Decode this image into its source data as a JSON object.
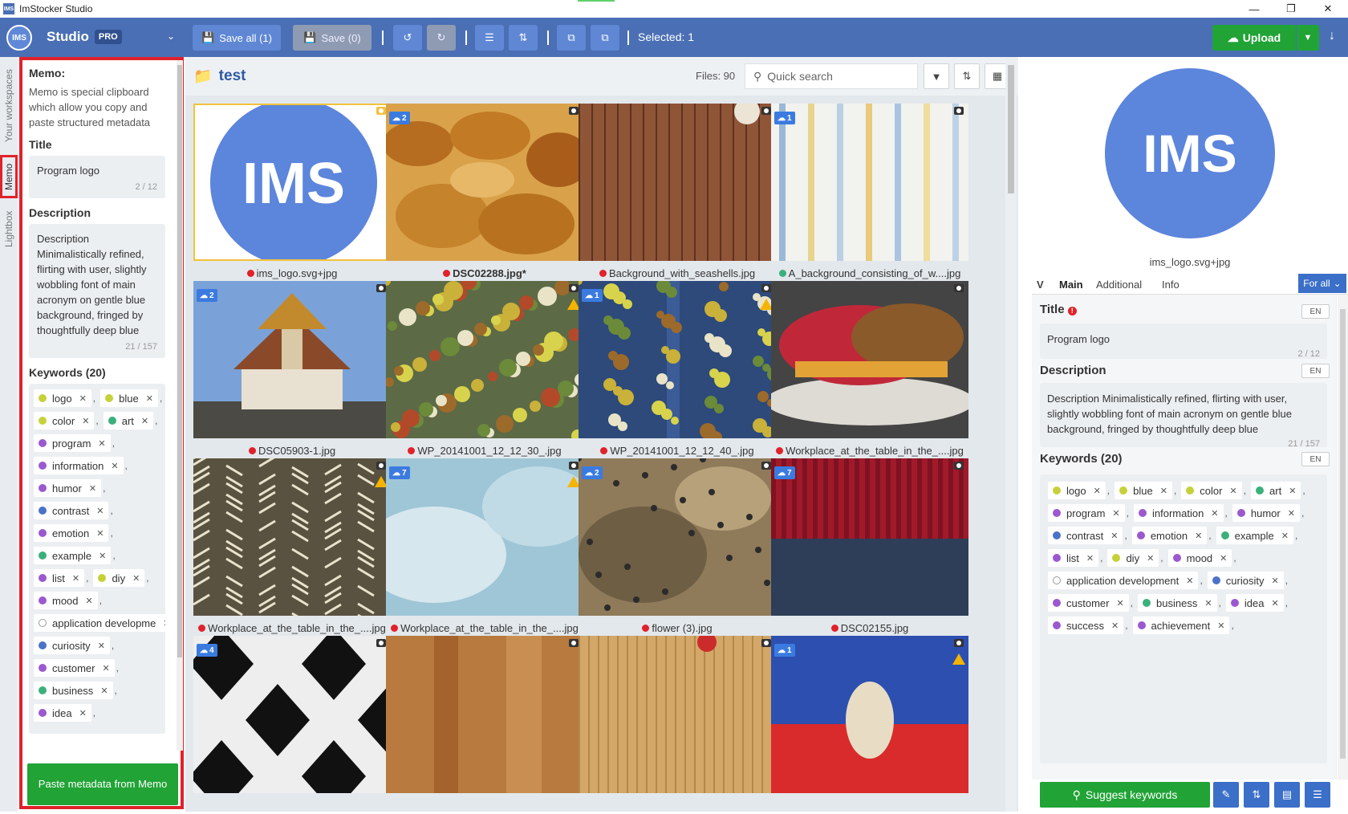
{
  "window": {
    "title": "ImStocker Studio",
    "app_icon": "IMS"
  },
  "toolbar": {
    "avatar": "IMS",
    "studio": "Studio",
    "pro": "PRO",
    "save_all": "Save all (1)",
    "save": "Save (0)",
    "selected": "Selected: 1",
    "upload": "Upload"
  },
  "side_tabs": [
    "Your workspaces",
    "Memo",
    "Lightbox"
  ],
  "memo": {
    "heading": "Memo:",
    "intro": "Memo is special clipboard which allow you copy and paste structured metadata",
    "title_label": "Title",
    "title_value": "Program logo",
    "title_count": "2 / 12",
    "desc_label": "Description",
    "desc_value": "Description Minimalistically refined, flirting with user, slightly wobbling font of main acronym on gentle blue background, fringed by thoughtfully deep blue",
    "desc_count": "21 / 157",
    "kw_label": "Keywords (20)",
    "keyword_lines": [
      [
        {
          "t": "logo",
          "c": "#c6d13a"
        },
        {
          "t": "blue",
          "c": "#c6d13a"
        }
      ],
      [
        {
          "t": "color",
          "c": "#c6d13a"
        },
        {
          "t": "art",
          "c": "#3bb07c"
        }
      ],
      [
        {
          "t": "program",
          "c": "#9b59d0"
        }
      ],
      [
        {
          "t": "information",
          "c": "#9b59d0"
        }
      ],
      [
        {
          "t": "humor",
          "c": "#9b59d0"
        }
      ],
      [
        {
          "t": "contrast",
          "c": "#4a72c8"
        }
      ],
      [
        {
          "t": "emotion",
          "c": "#9b59d0"
        }
      ],
      [
        {
          "t": "example",
          "c": "#3bb07c"
        }
      ],
      [
        {
          "t": "list",
          "c": "#9b59d0"
        },
        {
          "t": "diy",
          "c": "#c6d13a"
        }
      ],
      [
        {
          "t": "mood",
          "c": "#9b59d0"
        }
      ],
      [
        {
          "t": "application developme",
          "c": "#ffffff"
        }
      ],
      [
        {
          "t": "curiosity",
          "c": "#4a72c8"
        }
      ],
      [
        {
          "t": "customer",
          "c": "#9b59d0"
        }
      ],
      [
        {
          "t": "business",
          "c": "#3bb07c"
        }
      ],
      [
        {
          "t": "idea",
          "c": "#9b59d0"
        }
      ]
    ],
    "paste_button": "Paste metadata from Memo"
  },
  "center": {
    "folder": "test",
    "files": "Files: 90",
    "search_placeholder": "Quick search",
    "tiles": [
      {
        "name": "ims_logo.svg+jpg",
        "badge": "",
        "kind": "logo",
        "sel": true,
        "dot": "#e0222b",
        "bold": false,
        "warn": false
      },
      {
        "name": "DSC02288.jpg*",
        "badge": "2",
        "kind": "bread",
        "sel": false,
        "dot": "#e0222b",
        "bold": true,
        "warn": false
      },
      {
        "name": "Background_with_seashells.jpg",
        "badge": "",
        "kind": "wood",
        "sel": false,
        "dot": "#e0222b",
        "bold": false,
        "warn": false
      },
      {
        "name": "A_background_consisting_of_w....jpg",
        "badge": "1",
        "kind": "stripes",
        "sel": false,
        "dot": "#3bb07c",
        "bold": false,
        "warn": false
      },
      {
        "name": "DSC05903-1.jpg",
        "badge": "2",
        "kind": "temple",
        "sel": false,
        "dot": "#e0222b",
        "bold": false,
        "warn": false
      },
      {
        "name": "WP_20141001_12_12_30_.jpg",
        "badge": "",
        "kind": "leaves",
        "sel": false,
        "dot": "#e0222b",
        "bold": false,
        "warn": true
      },
      {
        "name": "WP_20141001_12_12_40_.jpg",
        "badge": "1",
        "kind": "leaves2",
        "sel": false,
        "dot": "#e0222b",
        "bold": false,
        "warn": true
      },
      {
        "name": "Workplace_at_the_table_in_the_....jpg",
        "badge": "",
        "kind": "burger",
        "sel": false,
        "dot": "#e0222b",
        "bold": false,
        "warn": false
      },
      {
        "name": "Workplace_at_the_table_in_the_....jpg",
        "badge": "",
        "kind": "straw",
        "sel": false,
        "dot": "#e0222b",
        "bold": false,
        "warn": true
      },
      {
        "name": "Workplace_at_the_table_in_the_....jpg",
        "badge": "7",
        "kind": "ice",
        "sel": false,
        "dot": "#e0222b",
        "bold": false,
        "warn": true
      },
      {
        "name": "flower (3).jpg",
        "badge": "2",
        "kind": "stone",
        "sel": false,
        "dot": "#e0222b",
        "bold": false,
        "warn": false
      },
      {
        "name": "DSC02155.jpg",
        "badge": "7",
        "kind": "knit",
        "sel": false,
        "dot": "#e0222b",
        "bold": false,
        "warn": false
      },
      {
        "name": "",
        "badge": "4",
        "kind": "checker",
        "sel": false,
        "dot": "",
        "bold": false,
        "warn": false
      },
      {
        "name": "",
        "badge": "",
        "kind": "woodb",
        "sel": false,
        "dot": "",
        "bold": false,
        "warn": false
      },
      {
        "name": "",
        "badge": "",
        "kind": "bamboo",
        "sel": false,
        "dot": "",
        "bold": false,
        "warn": false
      },
      {
        "name": "",
        "badge": "1",
        "kind": "shell",
        "sel": false,
        "dot": "",
        "bold": false,
        "warn": true
      }
    ]
  },
  "right": {
    "preview_text": "IMS",
    "preview_name": "ims_logo.svg+jpg",
    "tabs": [
      "Main",
      "Additional",
      "Info"
    ],
    "for_all": "For all",
    "title_label": "Title",
    "title_value": "Program logo",
    "title_count": "2 / 12",
    "desc_label": "Description",
    "desc_value": "Description Minimalistically refined, flirting with user, slightly wobbling font of main acronym on gentle blue background, fringed by thoughtfully deep blue",
    "desc_count": "21 / 157",
    "kw_label": "Keywords (20)",
    "lang": "EN",
    "keyword_lines": [
      [
        {
          "t": "logo",
          "c": "#c6d13a"
        },
        {
          "t": "blue",
          "c": "#c6d13a"
        },
        {
          "t": "color",
          "c": "#c6d13a"
        },
        {
          "t": "art",
          "c": "#3bb07c"
        }
      ],
      [
        {
          "t": "program",
          "c": "#9b59d0"
        },
        {
          "t": "information",
          "c": "#9b59d0"
        },
        {
          "t": "humor",
          "c": "#9b59d0"
        }
      ],
      [
        {
          "t": "contrast",
          "c": "#4a72c8"
        },
        {
          "t": "emotion",
          "c": "#9b59d0"
        },
        {
          "t": "example",
          "c": "#3bb07c"
        }
      ],
      [
        {
          "t": "list",
          "c": "#9b59d0"
        },
        {
          "t": "diy",
          "c": "#c6d13a"
        },
        {
          "t": "mood",
          "c": "#9b59d0"
        }
      ],
      [
        {
          "t": "application development",
          "c": "#ffffff"
        },
        {
          "t": "curiosity",
          "c": "#4a72c8"
        }
      ],
      [
        {
          "t": "customer",
          "c": "#9b59d0"
        },
        {
          "t": "business",
          "c": "#3bb07c"
        },
        {
          "t": "idea",
          "c": "#9b59d0"
        }
      ],
      [
        {
          "t": "success",
          "c": "#9b59d0"
        },
        {
          "t": "achievement",
          "c": "#9b59d0"
        }
      ]
    ],
    "suggest": "Suggest keywords"
  }
}
